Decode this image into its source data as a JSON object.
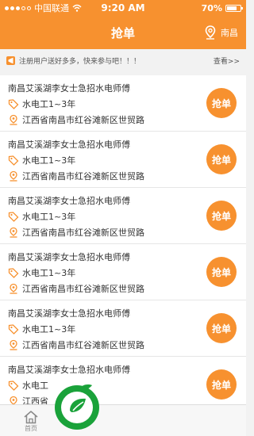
{
  "status_bar": {
    "carrier": "中国联通",
    "time": "9:20 AM",
    "battery": "70%"
  },
  "nav": {
    "title": "抢单",
    "city": "南昌"
  },
  "notice": {
    "text": "注册用户送好多多，快来参与吧！！！",
    "more": "查看>>"
  },
  "jobs": [
    {
      "title": "南昌艾溪湖李女士急招水电师傅",
      "type": "水电工1~3年",
      "address": "江西省南昌市红谷滩新区世贸路",
      "button": "抢单"
    },
    {
      "title": "南昌艾溪湖李女士急招水电师傅",
      "type": "水电工1~3年",
      "address": "江西省南昌市红谷滩新区世贸路",
      "button": "抢单"
    },
    {
      "title": "南昌艾溪湖李女士急招水电师傅",
      "type": "水电工1~3年",
      "address": "江西省南昌市红谷滩新区世贸路",
      "button": "抢单"
    },
    {
      "title": "南昌艾溪湖李女士急招水电师傅",
      "type": "水电工1~3年",
      "address": "江西省南昌市红谷滩新区世贸路",
      "button": "抢单"
    },
    {
      "title": "南昌艾溪湖李女士急招水电师傅",
      "type": "水电工1~3年",
      "address": "江西省南昌市红谷滩新区世贸路",
      "button": "抢单"
    },
    {
      "title": "南昌艾溪湖李女士急招水电师傅",
      "type": "水电工",
      "address": "江西省",
      "button": "抢单"
    }
  ],
  "tab_bar": {
    "home": "首页"
  },
  "colors": {
    "accent": "#f7912f",
    "logo_green": "#1aa23a"
  },
  "icons": {
    "notice": "megaphone-icon",
    "location": "map-pin-icon",
    "tag": "tag-icon",
    "address": "location-icon",
    "home": "home-icon"
  }
}
